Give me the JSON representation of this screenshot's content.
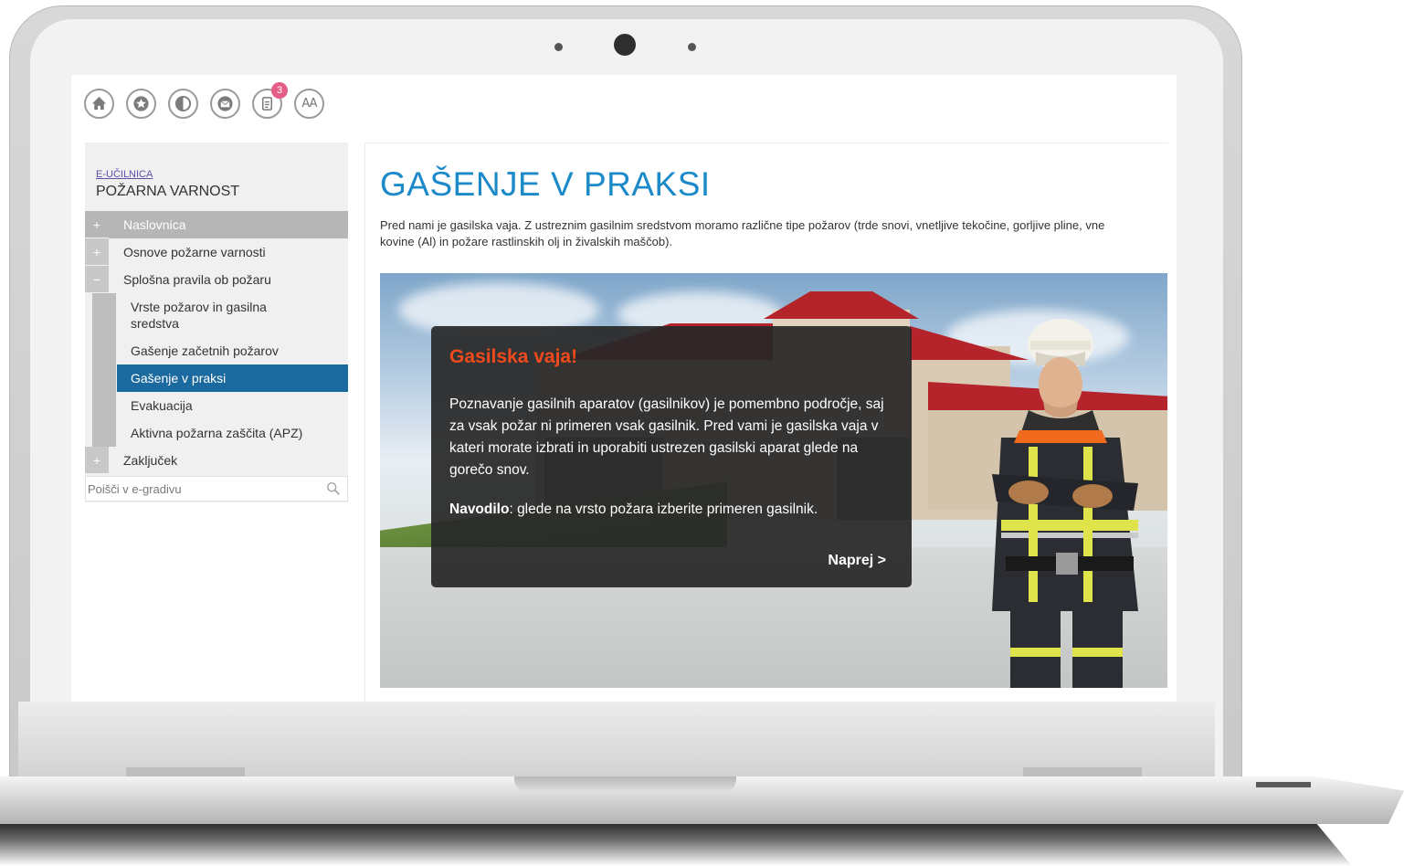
{
  "toolbar": {
    "icons": [
      "home-icon",
      "star-icon",
      "contrast-icon",
      "mail-icon",
      "notes-icon",
      "font-size-icon"
    ],
    "badge_count": "3",
    "font_label": "AA"
  },
  "sidebar": {
    "breadcrumb_link": "E-UČILNICA",
    "course_title": "POŽARNA VARNOST",
    "items": [
      {
        "label": "Naslovnica",
        "toggle": "+"
      },
      {
        "label": "Osnove požarne varnosti",
        "toggle": "+"
      },
      {
        "label": "Splošna pravila ob požaru",
        "toggle": "−"
      },
      {
        "label": "Vrste požarov in gasilna sredstva"
      },
      {
        "label": "Gašenje začetnih požarov"
      },
      {
        "label": "Gašenje v praksi"
      },
      {
        "label": "Evakuacija"
      },
      {
        "label": "Aktivna požarna zaščita (APZ)"
      },
      {
        "label": "Zaključek",
        "toggle": "+"
      }
    ],
    "search_placeholder": "Poišči v e-gradivu"
  },
  "content": {
    "title": "GAŠENJE V PRAKSI",
    "intro": "Pred nami je gasilska vaja. Z ustreznim gasilnim sredstvom moramo različne tipe požarov (trde snovi, vnetljive tekočine, gorljive pline, vne\nkovine (Al) in požare rastlinskih olj in živalskih maščob)."
  },
  "dialog": {
    "title": "Gasilska vaja!",
    "body": "Poznavanje gasilnih aparatov (gasilnikov) je pomembno področje, saj za vsak požar ni primeren vsak gasilnik. Pred vami je gasilska vaja v kateri morate izbrati in  uporabiti ustrezen gasilski aparat glede na gorečo snov.",
    "instruction_label": "Navodilo",
    "instruction_text": ": glede na vrsto požara izberite primeren gasilnik.",
    "next_label": "Naprej >"
  },
  "colors": {
    "title_blue": "#1c8ac9",
    "active_item": "#1b6a9f",
    "dialog_title": "#f04a1c",
    "badge": "#e35d87"
  }
}
